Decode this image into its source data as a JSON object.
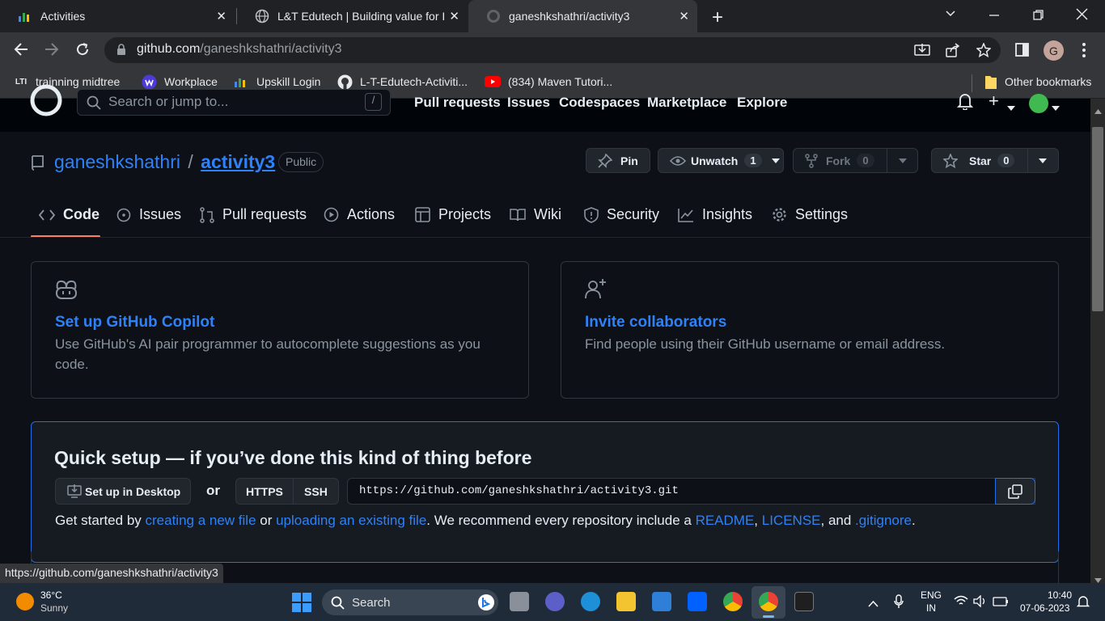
{
  "browser": {
    "tabs": [
      {
        "title": "Activities",
        "close": "✕"
      },
      {
        "title": "L&T Edutech | Building value for I",
        "close": "✕"
      },
      {
        "title": "ganeshkshathri/activity3",
        "close": "✕"
      }
    ],
    "new_tab": "+",
    "url_host": "github.com",
    "url_path": "/ganeshkshathri/activity3",
    "profile_initial": "G",
    "bookmarks": [
      {
        "label": "trainning midtree"
      },
      {
        "label": "Workplace"
      },
      {
        "label": "Upskill Login"
      },
      {
        "label": "L-T-Edutech-Activiti..."
      },
      {
        "label": "(834) Maven Tutori..."
      }
    ],
    "other_bookmarks": "Other bookmarks",
    "lti_badge": "LTI"
  },
  "github": {
    "search_placeholder": "Search or jump to...",
    "search_key": "/",
    "nav": [
      "Pull requests",
      "Issues",
      "Codespaces",
      "Marketplace",
      "Explore"
    ],
    "plus": "+",
    "owner": "ganeshkshathri",
    "slash": "/",
    "repo": "activity3",
    "visibility": "Public",
    "pin_label": "Pin",
    "unwatch_label": "Unwatch",
    "unwatch_count": "1",
    "fork_label": "Fork",
    "fork_count": "0",
    "star_label": "Star",
    "star_count": "0",
    "tabs": [
      "Code",
      "Issues",
      "Pull requests",
      "Actions",
      "Projects",
      "Wiki",
      "Security",
      "Insights",
      "Settings"
    ],
    "active_tab": "Code",
    "copilot_title": "Set up GitHub Copilot",
    "copilot_desc": "Use GitHub's AI pair programmer to autocomplete suggestions as you code.",
    "invite_title": "Invite collaborators",
    "invite_desc": "Find people using their GitHub username or email address.",
    "quick_title": "Quick setup — if you’ve done this kind of thing before",
    "desktop_btn": "Set up in Desktop",
    "or": "or",
    "https": "HTTPS",
    "ssh": "SSH",
    "clone_url": "https://github.com/ganeshkshathri/activity3.git",
    "hint": {
      "p1": "Get started by ",
      "l1": "creating a new file",
      "p2": " or ",
      "l2": "uploading an existing file",
      "p3": ". We recommend every repository include a ",
      "l3": "README",
      "p4": ", ",
      "l4": "LICENSE",
      "p5": ", and ",
      "l5": ".gitignore",
      "p6": "."
    },
    "status_url": "https://github.com/ganeshkshathri/activity3"
  },
  "taskbar": {
    "weather_temp": "36°C",
    "weather_desc": "Sunny",
    "search": "Search",
    "lang1": "ENG",
    "lang2": "IN",
    "time": "10:40",
    "date": "07-06-2023"
  },
  "colors": {
    "accent": "#2f81f7",
    "active_underline": "#f78166",
    "bg": "#0d1117"
  }
}
